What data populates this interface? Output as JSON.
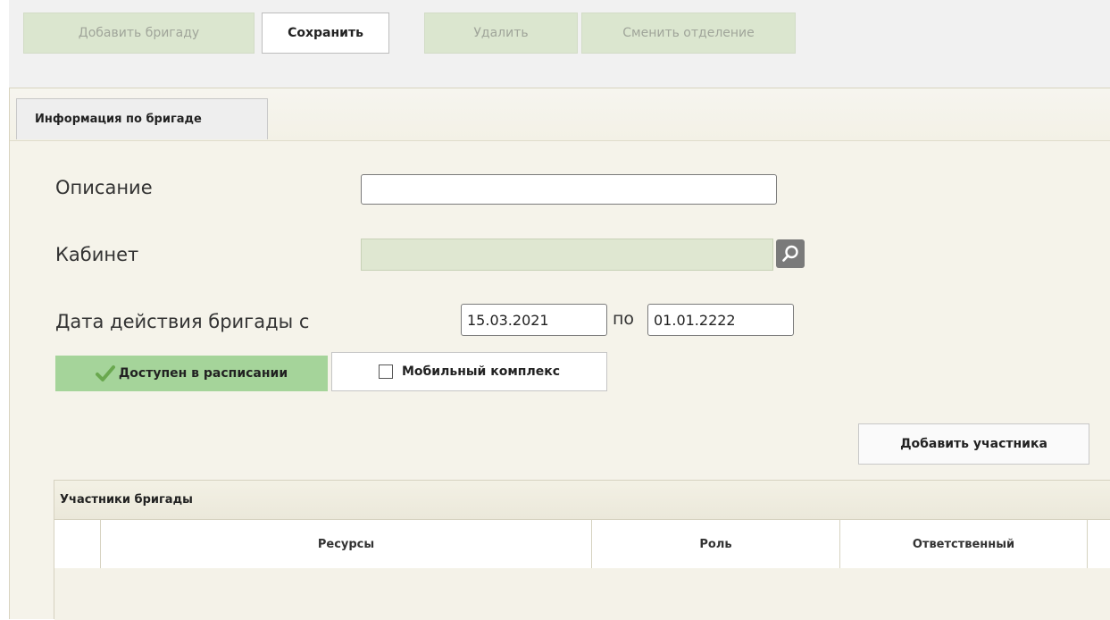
{
  "toolbar": {
    "add_brigade": "Добавить бригаду",
    "save": "Сохранить",
    "delete": "Удалить",
    "change_department": "Сменить отделение"
  },
  "tabs": [
    {
      "label": "Информация по бригаде",
      "active": true
    }
  ],
  "form": {
    "description_label": "Описание",
    "description_value": "",
    "cabinet_label": "Кабинет",
    "cabinet_value": "",
    "date_label": "Дата действия бригады с",
    "date_from": "15.03.2021",
    "date_to_label": "по",
    "date_to": "01.01.2222"
  },
  "toggles": {
    "available_in_schedule": {
      "label": "Доступен в расписании",
      "checked": true
    },
    "mobile_complex": {
      "label": "Мобильный комплекс",
      "checked": false
    }
  },
  "add_member_label": "Добавить участника",
  "members_grid": {
    "title": "Участники бригады",
    "columns": [
      "",
      "Ресурсы",
      "Роль",
      "Ответственный"
    ],
    "rows": []
  },
  "colors": {
    "disabled_button_bg": "#dbe6cf",
    "toggle_on_bg": "#a5d49a",
    "checkmark": "#6aa84f",
    "panel_bg": "#f5f3ea"
  },
  "icons": {
    "lookup": "search-icon",
    "checkmark": "checkmark-icon",
    "checkbox": "checkbox-icon"
  }
}
